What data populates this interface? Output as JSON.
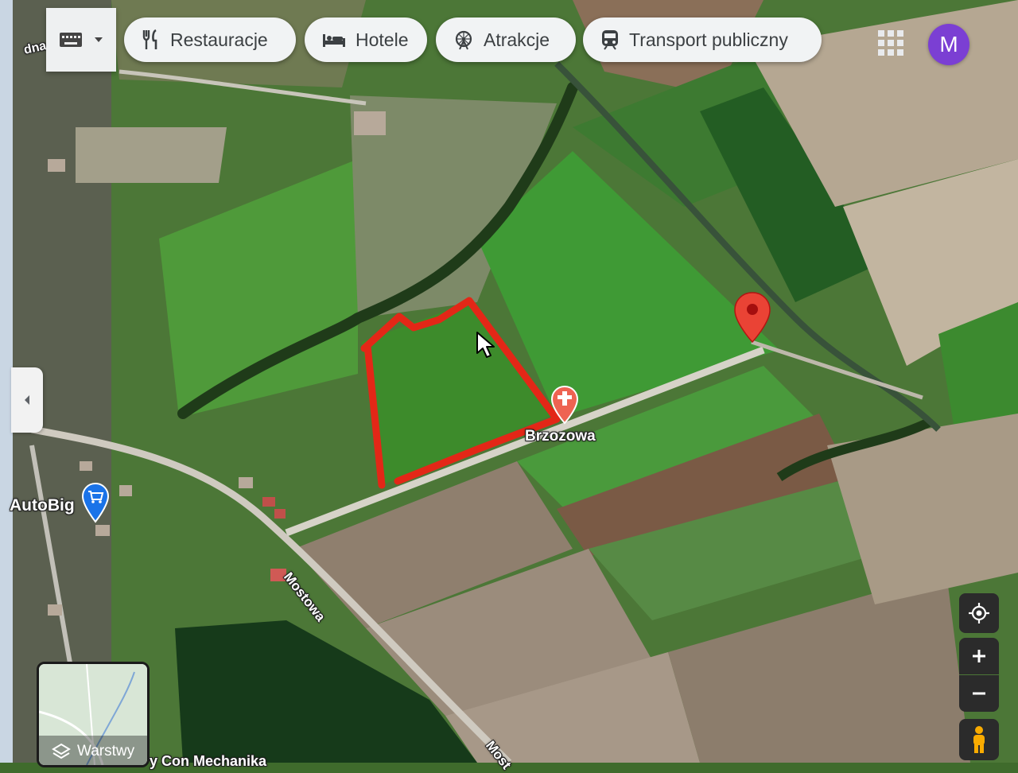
{
  "chips": [
    {
      "label": "Restauracje",
      "icon": "fork-knife-icon"
    },
    {
      "label": "Hotele",
      "icon": "bed-icon"
    },
    {
      "label": "Atrakcje",
      "icon": "ferris-wheel-icon"
    },
    {
      "label": "Transport publiczny",
      "icon": "train-icon"
    }
  ],
  "account": {
    "initial": "M",
    "color": "#7b3fd3"
  },
  "edge_text": "dna",
  "map": {
    "street_brzozowa": "Brzozowa",
    "street_mostowa": "Mostowa",
    "street_mostowa_2": "Most",
    "business_autobig": "AutoBig",
    "bottom_partial": "y Con   Mechanika"
  },
  "layers_label": "Warstwy",
  "colors": {
    "marker": "#ea4335",
    "outline": "#e32717",
    "avatar": "#7b3fd3",
    "shop_pin": "#1a73e8"
  }
}
